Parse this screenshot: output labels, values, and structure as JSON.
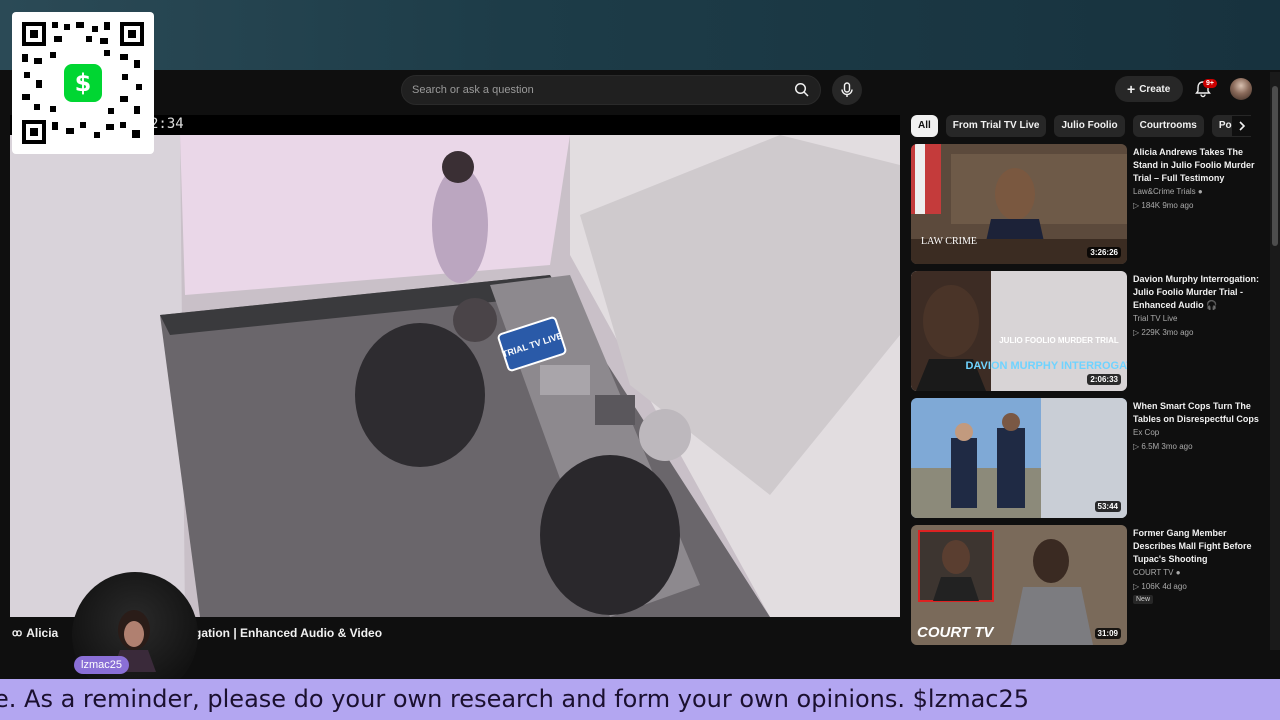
{
  "header": {
    "search_placeholder": "Search or ask a question",
    "create_label": "Create",
    "notification_count": "9+"
  },
  "player": {
    "timestamp_fragment": "2:34",
    "watermark_text": "TRIAL TV LIVE"
  },
  "video": {
    "title_start": "Alicia",
    "title_end": "rogation | Enhanced Audio & Video"
  },
  "chips": [
    "All",
    "From Trial TV Live",
    "Julio Foolio",
    "Courtrooms",
    "Politics"
  ],
  "recommendations": [
    {
      "title": "Alicia Andrews Takes The Stand in Julio Foolio Murder Trial – Full Testimony",
      "channel": "Law&Crime Trials",
      "verified": true,
      "views": "184K",
      "age": "9mo ago",
      "duration": "3:26:26",
      "thumb_text": "LAW CRIME",
      "is_new": false
    },
    {
      "title": "Davion Murphy Interrogation: Julio Foolio Murder Trial - Enhanced Audio 🎧",
      "channel": "Trial TV Live",
      "verified": false,
      "views": "229K",
      "age": "3mo ago",
      "duration": "2:06:33",
      "thumb_text": "JULIO FOOLIO MURDER TRIAL",
      "thumb_text2": "DAVION MURPHY INTERROGATION",
      "is_new": false
    },
    {
      "title": "When Smart Cops Turn The Tables on Disrespectful Cops",
      "channel": "Ex Cop",
      "verified": false,
      "views": "6.5M",
      "age": "3mo ago",
      "duration": "53:44",
      "is_new": false
    },
    {
      "title": "Former Gang Member Describes Mall Fight Before Tupac's Shooting",
      "channel": "COURT TV",
      "verified": true,
      "views": "106K",
      "age": "4d ago",
      "duration": "31:09",
      "thumb_text": "COURT TV",
      "is_new": true,
      "new_label": "New"
    }
  ],
  "overlay": {
    "streamer_name": "lzmac25",
    "ticker": "e. As a reminder, please do your own research and form your own opinions. $lzmac25"
  },
  "colors": {
    "ticker_bg": "#b3a6f1",
    "cashapp_green": "#00d632",
    "label_purple": "#8a6fd6"
  }
}
